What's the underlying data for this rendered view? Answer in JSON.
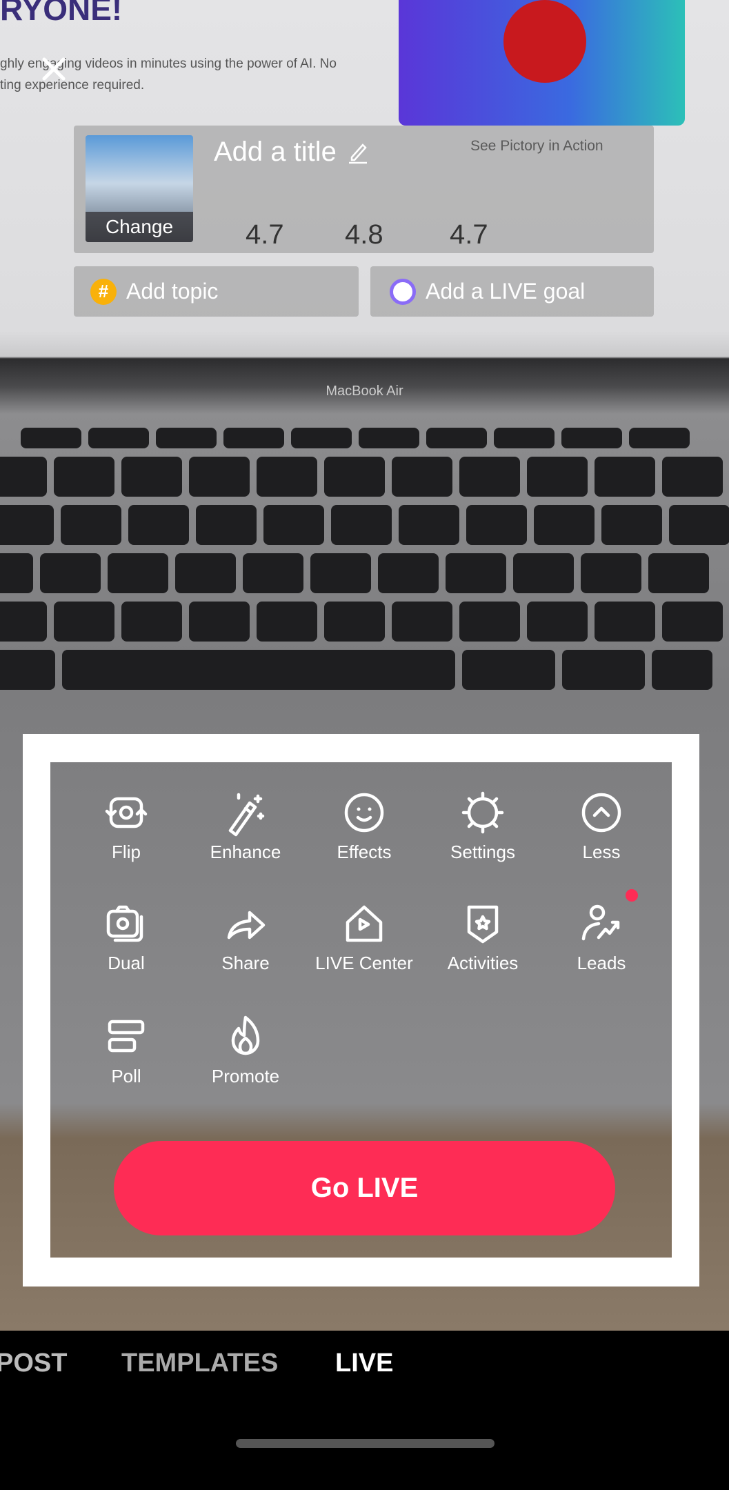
{
  "background": {
    "screen_heading": "RYONE!",
    "screen_subtext": [
      "ghly engaging videos in minutes using the power of AI. No",
      "ting experience required."
    ],
    "see_action": "See Pictory in Action",
    "ratings": [
      "4.7",
      "4.8",
      "4.7"
    ],
    "laptop_label": "MacBook Air"
  },
  "header": {
    "close_icon": "close-icon"
  },
  "title_panel": {
    "cover_button": "Change",
    "title_placeholder": "Add a title"
  },
  "topic": {
    "label": "Add topic",
    "icon": "hashtag-icon"
  },
  "goal": {
    "label": "Add a LIVE goal",
    "icon": "target-icon"
  },
  "tools": [
    {
      "label": "Flip",
      "icon": "flip-camera-icon"
    },
    {
      "label": "Enhance",
      "icon": "magic-wand-icon"
    },
    {
      "label": "Effects",
      "icon": "smiley-icon"
    },
    {
      "label": "Settings",
      "icon": "gear-icon"
    },
    {
      "label": "Less",
      "icon": "chevron-up-circle-icon"
    },
    {
      "label": "Dual",
      "icon": "dual-camera-icon"
    },
    {
      "label": "Share",
      "icon": "share-arrow-icon"
    },
    {
      "label": "LIVE Center",
      "icon": "live-center-house-icon"
    },
    {
      "label": "Activities",
      "icon": "badge-star-icon"
    },
    {
      "label": "Leads",
      "icon": "person-trend-icon"
    },
    {
      "label": "Poll",
      "icon": "poll-icon"
    },
    {
      "label": "Promote",
      "icon": "flame-icon"
    }
  ],
  "go_live": "Go LIVE",
  "colors": {
    "accent": "#fe2c55",
    "topic": "#f9b10a",
    "goal": "#8a6cf7"
  },
  "bottom_tabs": [
    {
      "label": "POST",
      "active": false
    },
    {
      "label": "TEMPLATES",
      "active": false
    },
    {
      "label": "LIVE",
      "active": true
    }
  ]
}
